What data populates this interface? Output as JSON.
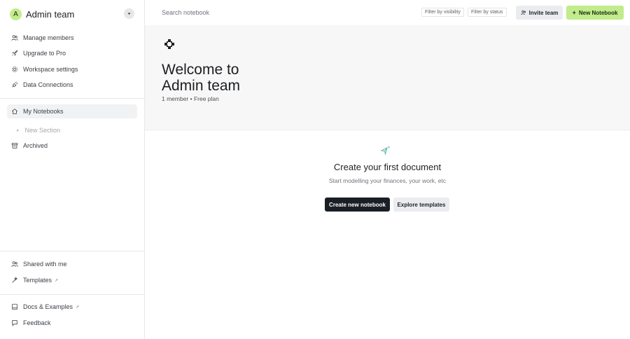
{
  "workspace": {
    "avatar_letter": "A",
    "name": "Admin team"
  },
  "sidebar": {
    "top_items": [
      {
        "label": "Manage members",
        "icon": "users-icon"
      },
      {
        "label": "Upgrade to Pro",
        "icon": "rocket-icon"
      },
      {
        "label": "Workspace settings",
        "icon": "gear-icon"
      },
      {
        "label": "Data Connections",
        "icon": "plug-icon"
      }
    ],
    "notebooks": {
      "label": "My Notebooks",
      "icon": "home-icon"
    },
    "new_section": {
      "label": "New Section"
    },
    "archived": {
      "label": "Archived",
      "icon": "archive-icon"
    },
    "bottom_items": [
      {
        "label": "Shared with me",
        "icon": "users-icon"
      },
      {
        "label": "Templates",
        "icon": "wand-icon",
        "external": "↗"
      }
    ],
    "footer_items": [
      {
        "label": "Docs & Examples",
        "icon": "book-icon",
        "external": "↗"
      },
      {
        "label": "Feedback",
        "icon": "chat-icon"
      }
    ]
  },
  "topbar": {
    "search_placeholder": "Search notebook",
    "filter_visibility": "Filter by visibility",
    "filter_status": "Filter by status",
    "invite_label": "Invite team",
    "new_notebook_label": "New Notebook",
    "new_notebook_plus": "+"
  },
  "hero": {
    "title_line1": "Welcome to",
    "title_line2": "Admin team",
    "meta": "1 member • Free plan"
  },
  "empty_state": {
    "title": "Create your first document",
    "subtitle": "Start modelling your finances, your work, etc",
    "create_label": "Create new notebook",
    "explore_label": "Explore templates"
  },
  "colors": {
    "accent": "#c0ec8b",
    "dark_button": "#1a1f26"
  }
}
